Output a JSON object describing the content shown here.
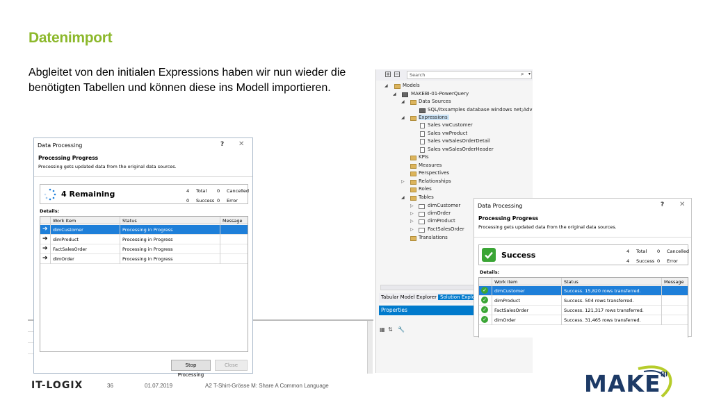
{
  "slide": {
    "title": "Datenimport",
    "body": "Abgleitet von den initialen Expressions haben wir nun wieder die benötigten Tabellen und können diese ins Modell importieren."
  },
  "dialog_left": {
    "title": "Data Processing",
    "help": "?",
    "close_icon": "close-icon",
    "heading": "Processing Progress",
    "subtitle": "Processing gets updated data from the original data sources.",
    "status_text": "4 Remaining",
    "status_icon": "spinner-icon",
    "stats": {
      "total_count": "4",
      "total_label": "Total",
      "cancelled_count": "0",
      "cancelled_label": "Cancelled",
      "success_count": "0",
      "success_label": "Success",
      "error_count": "0",
      "error_label": "Error"
    },
    "details_label": "Details:",
    "columns": [
      "Work Item",
      "Status",
      "Message"
    ],
    "rows": [
      {
        "item": "dimCustomer",
        "status": "Processing in Progress",
        "message": "",
        "selected": true
      },
      {
        "item": "dimProduct",
        "status": "Processing in Progress",
        "message": ""
      },
      {
        "item": "FactSalesOrder",
        "status": "Processing in Progress",
        "message": ""
      },
      {
        "item": "dimOrder",
        "status": "Processing in Progress",
        "message": ""
      }
    ],
    "stop_button": "Stop Processing",
    "close_button": "Close"
  },
  "explorer": {
    "search_placeholder": "Search",
    "tree": {
      "models": "Models",
      "model": "MAKEBI-01-PowerQuery",
      "data_sources": "Data Sources",
      "data_source_1": "SQL/itxsamples database windows net;Adven",
      "expressions": "Expressions",
      "expr_1": "Sales vwCustomer",
      "expr_2": "Sales vwProduct",
      "expr_3": "Sales vwSalesOrderDetail",
      "expr_4": "Sales vwSalesOrderHeader",
      "kpis": "KPIs",
      "measures": "Measures",
      "perspectives": "Perspectives",
      "relationships": "Relationships",
      "roles": "Roles",
      "tables": "Tables",
      "table_1": "dimCustomer",
      "table_2": "dimOrder",
      "table_3": "dimProduct",
      "table_4": "FactSalesOrder",
      "translations": "Translations"
    },
    "tab_1": "Tabular Model Explorer",
    "tab_2": "Solution Explor",
    "properties": "Properties"
  },
  "dialog_right": {
    "title": "Data Processing",
    "help": "?",
    "heading": "Processing Progress",
    "subtitle": "Processing gets updated data from the original data sources.",
    "status_text": "Success",
    "stats": {
      "total_count": "4",
      "total_label": "Total",
      "cancelled_count": "0",
      "cancelled_label": "Cancelled",
      "success_count": "4",
      "success_label": "Success",
      "error_count": "0",
      "error_label": "Error"
    },
    "details_label": "Details:",
    "columns": [
      "Work Item",
      "Status",
      "Message"
    ],
    "rows": [
      {
        "item": "dimCustomer",
        "status": "Success. 15,820 rows transferred.",
        "message": "",
        "selected": true
      },
      {
        "item": "dimProduct",
        "status": "Success. 504 rows transferred.",
        "message": ""
      },
      {
        "item": "FactSalesOrder",
        "status": "Success. 121,317 rows transferred.",
        "message": ""
      },
      {
        "item": "dimOrder",
        "status": "Success. 31,465 rows transferred.",
        "message": ""
      }
    ]
  },
  "footer": {
    "company": "IT-LOGIX",
    "page": "36",
    "date": "01.07.2019",
    "caption": "A2 T-Shirt-Grösse M: Share A Common Language",
    "brand": "MAKE",
    "brand_sup": "BI"
  },
  "colors": {
    "title_green": "#8cb82b",
    "selection_blue": "#1e7fd9",
    "vs_blue": "#007acc",
    "success_green": "#3aa535",
    "brand_navy": "#1d3a66",
    "brand_lime": "#b6cc2a"
  }
}
